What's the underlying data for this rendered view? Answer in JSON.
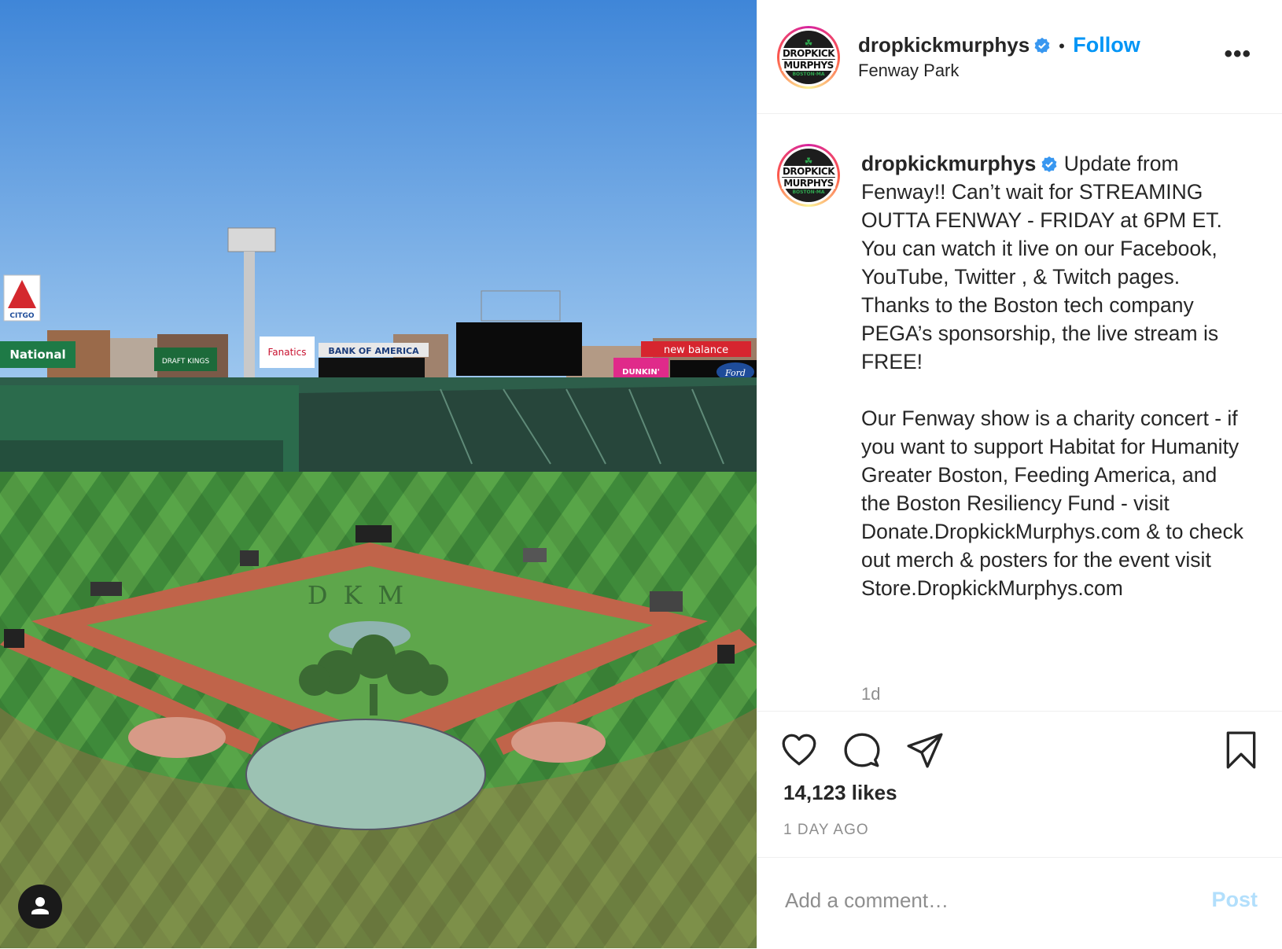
{
  "post": {
    "username": "dropkickmurphys",
    "follow_label": "Follow",
    "separator": "•",
    "location": "Fenway Park",
    "more_label": "•••",
    "caption_text": " Update from Fenway!! Can’t wait for STREAMING OUTTA FENWAY - FRIDAY at 6PM ET. You can watch it live on our Facebook, YouTube, Twitter , & Twitch pages. Thanks to the Boston tech company PEGA’s sponsorship, the live stream is FREE!\n\nOur Fenway show is a charity concert - if you want to support Habitat for Humanity Greater Boston, Feeding America, and the Boston Resiliency Fund - visit Donate.DropkickMurphys.com & to check out merch & posters for the event visit Store.DropkickMurphys.com",
    "caption_time": "1d",
    "likes": "14,123 likes",
    "posted_ago": "1 DAY AGO",
    "comment_placeholder": "Add a comment…",
    "post_button": "Post"
  },
  "logo": {
    "line1": "DROPKICK",
    "line2": "MURPHYS",
    "city": "BOSTON·MA"
  },
  "photo": {
    "field_text": "DKM",
    "signs": {
      "citgo": "CITGO",
      "national": "National",
      "fanatics": "Fanatics",
      "bank": "BANK OF AMERICA",
      "newbalance": "new balance",
      "dunkin": "DUNKIN'",
      "ford": "Ford",
      "draftkings": "DRAFT KINGS"
    }
  },
  "icons": {
    "verified": "verified-badge-icon",
    "like": "heart-icon",
    "comment": "comment-bubble-icon",
    "share": "paper-plane-icon",
    "save": "bookmark-icon",
    "profile": "user-icon"
  },
  "colors": {
    "follow": "#0095f6",
    "post_disabled": "#b2dffc",
    "secondary_text": "#8e8e8e",
    "verified": "#3897f0"
  }
}
